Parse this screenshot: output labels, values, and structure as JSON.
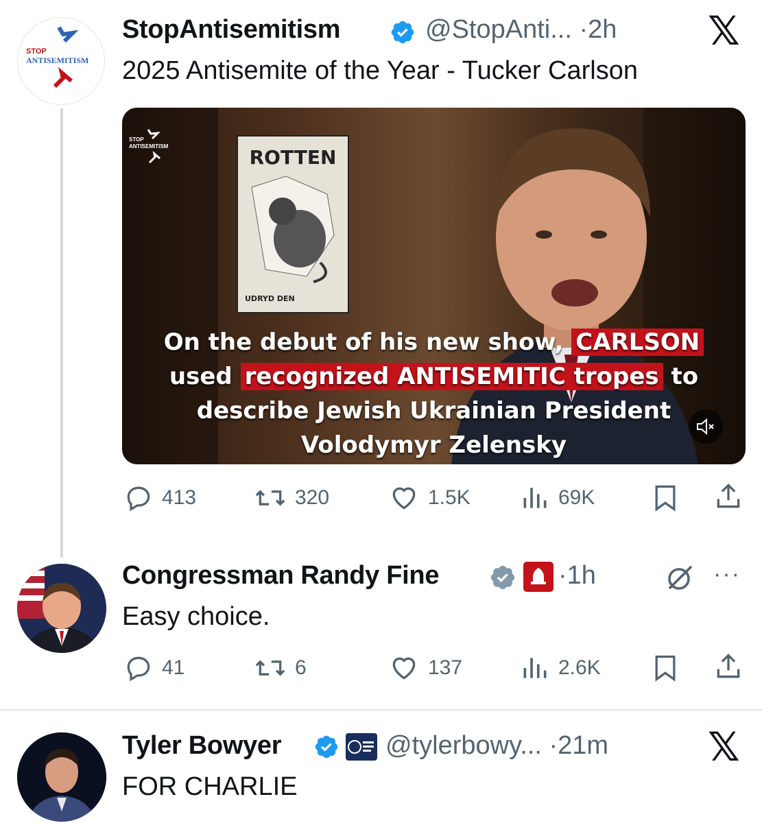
{
  "post1": {
    "author_name": "StopAntisemitism",
    "handle": "@StopAnti...",
    "time": "2h",
    "text": "2025 Antisemite of the Year - Tucker Carlson",
    "avatar_text_top": "STOP",
    "avatar_text_bottom": "ANTISEMITISM",
    "media": {
      "watermark_top": "STOP",
      "watermark_bottom": "ANTISEMITISM",
      "poster_title": "ROTTEN",
      "poster_caption": "UDRYD DEN",
      "caption_line1_a": "On the debut of his new show, ",
      "caption_line1_b": "CARLSON",
      "caption_line2_a": "used ",
      "caption_line2_b": "recognized ANTISEMITIC tropes",
      "caption_line2_c": " to",
      "caption_line3": "describe Jewish Ukrainian President",
      "caption_line4": "Volodymyr Zelensky"
    },
    "stats": {
      "replies": "413",
      "reposts": "320",
      "likes": "1.5K",
      "views": "69K"
    }
  },
  "post2": {
    "author_name": "Congressman Randy Fine",
    "time": "1h",
    "text": "Easy choice.",
    "stats": {
      "replies": "41",
      "reposts": "6",
      "likes": "137",
      "views": "2.6K"
    }
  },
  "post3": {
    "author_name": "Tyler Bowyer",
    "handle": "@tylerbowy...",
    "time": "21m",
    "text": "FOR CHARLIE"
  },
  "separator": "·",
  "colors": {
    "verified": "#1d9bf0",
    "verified_gov": "#829aab",
    "text": "#0f1419",
    "muted": "#536471",
    "caption_highlight": "#c4121a"
  },
  "icons": [
    "x-logo-icon",
    "verified-badge-icon",
    "reply-icon",
    "repost-icon",
    "like-icon",
    "views-icon",
    "bookmark-icon",
    "share-icon",
    "grok-icon",
    "more-icon",
    "mute-icon"
  ]
}
